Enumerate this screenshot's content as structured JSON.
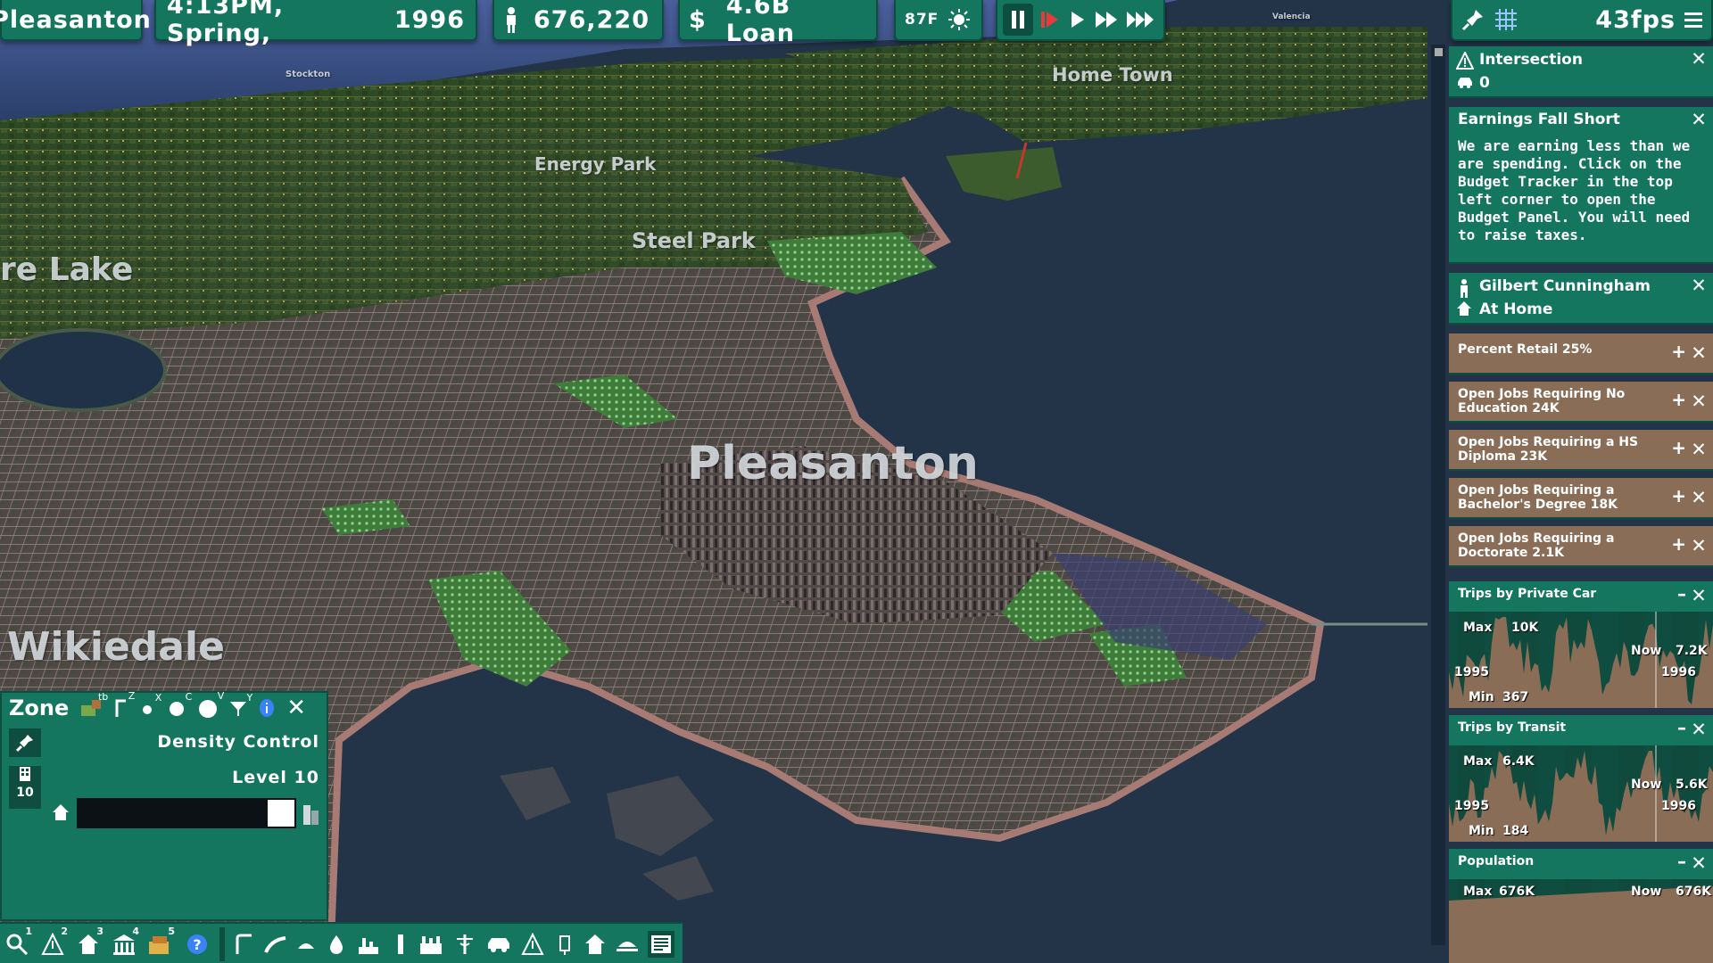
{
  "topbar": {
    "city": "Pleasanton",
    "datetime": "4:13PM, Spring,",
    "year": "1996",
    "population": "676,220",
    "money_symbol": "$",
    "money": "4.6B Loan",
    "temperature": "87F",
    "fps": "43fps"
  },
  "map_labels": {
    "pleasanton": "Pleasanton",
    "energy_park": "Energy Park",
    "steel_park": "Steel Park",
    "home_town": "Home Town",
    "lake": "re Lake",
    "wikiedale": "Wikiedale",
    "stockton": "Stockton",
    "valencia": "Valencia"
  },
  "panels": {
    "intersection": {
      "title": "Intersection",
      "count": "0"
    },
    "earnings": {
      "title": "Earnings Fall Short",
      "body": "We are earning less than we are spending. Click on the Budget Tracker in the top left corner to open the Budget Panel. You will need to raise taxes."
    },
    "person": {
      "name": "Gilbert Cunningham",
      "status": "At Home"
    },
    "stats": [
      {
        "text": "Percent Retail 25%"
      },
      {
        "text": "Open Jobs Requiring No Education 24K"
      },
      {
        "text": "Open Jobs Requiring a HS Diploma 23K"
      },
      {
        "text": "Open Jobs Requiring a Bachelor's Degree 18K"
      },
      {
        "text": "Open Jobs Requiring a Doctorate 2.1K"
      }
    ],
    "charts": [
      {
        "title": "Trips by Private Car",
        "max_label": "Max",
        "max": "10K",
        "now_label": "Now",
        "now": "7.2K",
        "min_label": "Min",
        "min": "367",
        "start": "1995",
        "end": "1996"
      },
      {
        "title": "Trips by Transit",
        "max_label": "Max",
        "max": "6.4K",
        "now_label": "Now",
        "now": "5.6K",
        "min_label": "Min",
        "min": "184",
        "start": "1995",
        "end": "1996"
      },
      {
        "title": "Population",
        "max_label": "Max",
        "max": "676K",
        "now_label": "Now",
        "now": "676K"
      }
    ]
  },
  "zone": {
    "title": "Zone",
    "key_tb": "tb",
    "key_z": "Z",
    "key_x": "X",
    "key_c": "C",
    "key_v": "V",
    "key_y": "Y",
    "mode": "Density Control",
    "level_label": "Level 10",
    "level_badge": "10",
    "density_fraction": 1.0
  },
  "bottombar": {
    "hotkeys": [
      "1",
      "2",
      "3",
      "4",
      "5"
    ]
  },
  "colors": {
    "panel": "#15765f",
    "panel_dark": "#0c4f40",
    "tan": "#8a6d57",
    "water": "#24374a"
  }
}
